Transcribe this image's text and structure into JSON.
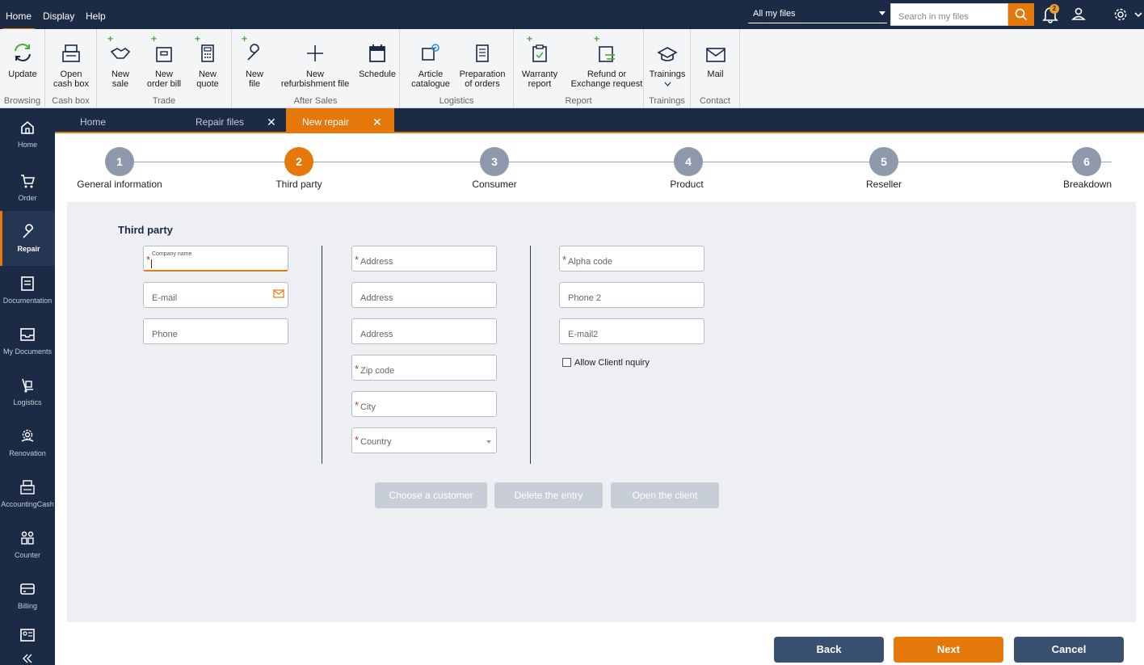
{
  "menu": {
    "home": "Home",
    "display": "Display",
    "help": "Help"
  },
  "top": {
    "files_select": "All my files",
    "search_placeholder": "Search in my files",
    "notifications_count": "2"
  },
  "ribbon": {
    "update": "Update",
    "open_cash_box": "Open\ncash box",
    "new_sale": "New\nsale",
    "new_order_bill": "New\norder bill",
    "new_quote": "New\nquote",
    "new_file": "New\nfile",
    "new_refurbishment_file": "New\nrefurbishment file",
    "schedule": "Schedule",
    "article_catalogue": "Article\ncatalogue",
    "preparation_of_orders": "Preparation\nof orders",
    "warranty_report": "Warranty\nreport",
    "refund_or_exchange": "Refund or\nExchange request",
    "trainings": "Trainings",
    "mail": "Mail",
    "groups": {
      "browsing": "Browsing",
      "cash_box": "Cash box",
      "trade": "Trade",
      "after_sales": "After Sales",
      "logistics": "Logistics",
      "report": "Report",
      "trainings": "Trainings",
      "contact": "Contact"
    }
  },
  "nav": {
    "home": "Home",
    "order": "Order",
    "repair": "Repair",
    "documentation": "Documentation",
    "my_documents": "My Documents",
    "logistics": "Logistics",
    "renovation": "Renovation",
    "accounting": "AccountingCash",
    "counter": "Counter",
    "billing": "Billing"
  },
  "tabs": {
    "home": "Home",
    "repair_files": "Repair files",
    "new_repair": "New repair"
  },
  "steps": [
    {
      "num": "1",
      "label": "General information"
    },
    {
      "num": "2",
      "label": "Third party"
    },
    {
      "num": "3",
      "label": "Consumer"
    },
    {
      "num": "4",
      "label": "Product"
    },
    {
      "num": "5",
      "label": "Reseller"
    },
    {
      "num": "6",
      "label": "Breakdown"
    }
  ],
  "form": {
    "title": "Third party",
    "company_name": "Company name",
    "email": "E-mail",
    "phone": "Phone",
    "address1": "Address",
    "address2": "Address",
    "address3": "Address",
    "zip": "Zip code",
    "city": "City",
    "country": "Country",
    "alpha_code": "Alpha code",
    "phone2": "Phone 2",
    "email2": "E-mail2",
    "allow_inquiry": "Allow Clientl nquiry",
    "choose_customer": "Choose a customer",
    "delete_entry": "Delete the entry",
    "open_client": "Open the client"
  },
  "footer": {
    "back": "Back",
    "next": "Next",
    "cancel": "Cancel"
  },
  "colors": {
    "navy": "#1c2b45",
    "accent": "#e5780b",
    "step_inactive": "#8e99ab",
    "back_button": "#3a5070"
  }
}
